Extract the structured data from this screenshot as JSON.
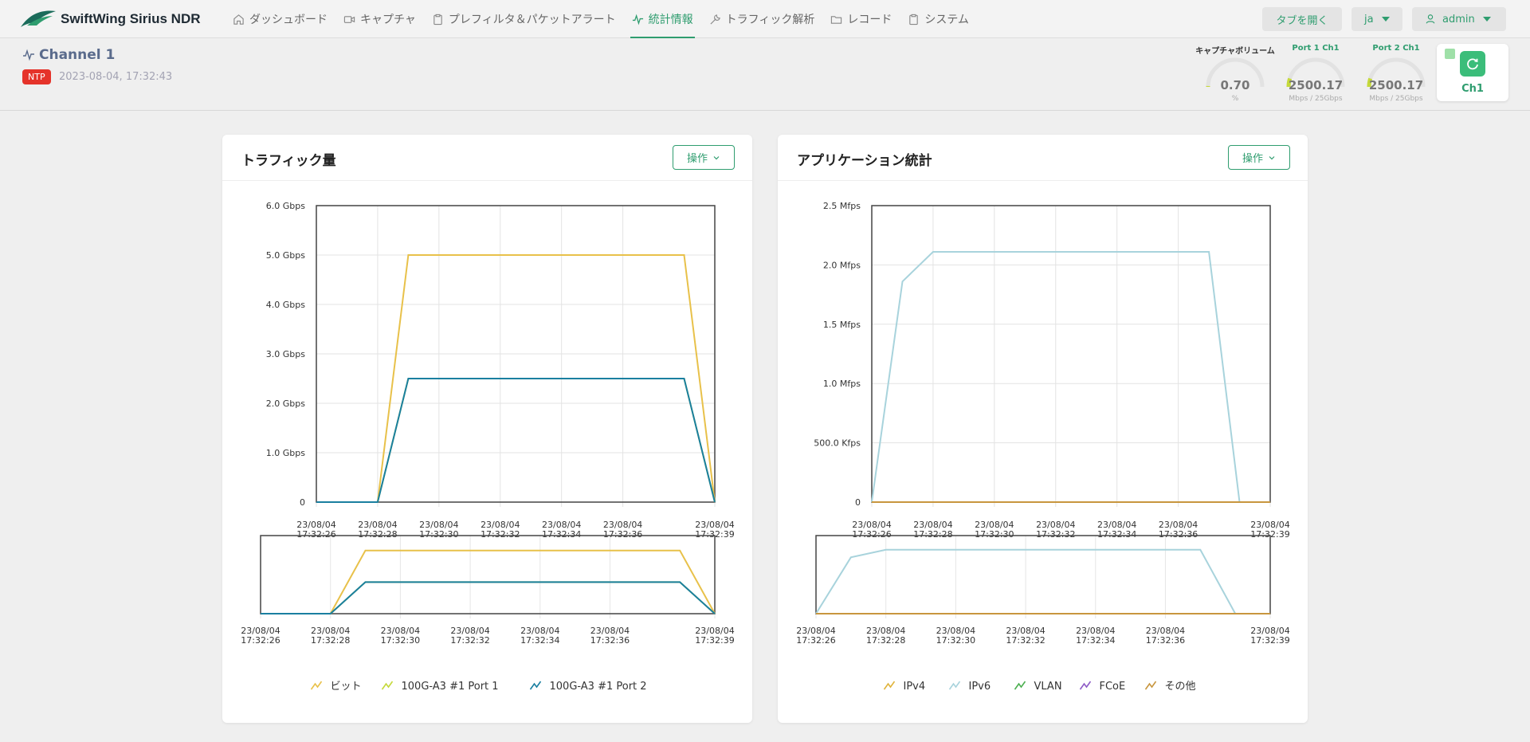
{
  "app": {
    "name": "SwiftWing Sirius NDR"
  },
  "nav": [
    {
      "label": "ダッシュボード",
      "icon": "home-icon",
      "active": false
    },
    {
      "label": "キャプチャ",
      "icon": "camera-icon",
      "active": false
    },
    {
      "label": "プレフィルタ＆パケットアラート",
      "icon": "clipboard-icon",
      "active": false
    },
    {
      "label": "統計情報",
      "icon": "activity-icon",
      "active": true
    },
    {
      "label": "トラフィック解析",
      "icon": "tools-icon",
      "active": false
    },
    {
      "label": "レコード",
      "icon": "folder-icon",
      "active": false
    },
    {
      "label": "システム",
      "icon": "clipboard-icon",
      "active": false
    }
  ],
  "toolbar": {
    "open_tab": "タブを開く",
    "language": "ja",
    "user": "admin"
  },
  "channel": {
    "title": "Channel 1",
    "badge": "NTP",
    "timestamp": "2023-08-04, 17:32:43"
  },
  "gauges": [
    {
      "label": "キャプチャボリューム",
      "value": "0.70",
      "unit": "%",
      "fraction": 0.007,
      "label_color": "#333333"
    },
    {
      "label": "Port 1 Ch1",
      "value": "2500.17",
      "unit": "Mbps / 25Gbps",
      "fraction": 0.1,
      "label_color": "#2f9d6f"
    },
    {
      "label": "Port 2 Ch1",
      "value": "2500.17",
      "unit": "Mbps / 25Gbps",
      "fraction": 0.1,
      "label_color": "#2f9d6f"
    }
  ],
  "channel_card": {
    "label": "Ch1"
  },
  "colors": {
    "accent": "#2f9d6f",
    "ntp": "#e5332a",
    "bit": "#e8c14a",
    "port1": "#c5d93a",
    "port2": "#1a7fa0",
    "ipv4": "#e0b43c",
    "ipv6": "#a8d3dc",
    "vlan": "#4caf50",
    "fcoe": "#8e5bc6",
    "other": "#c8963e"
  },
  "panels": {
    "traffic": {
      "title": "トラフィック量",
      "action": "操作"
    },
    "application": {
      "title": "アプリケーション統計",
      "action": "操作"
    }
  },
  "chart_data": [
    {
      "type": "line",
      "title": "トラフィック量",
      "ylim": [
        0,
        6
      ],
      "y_ticks": [
        "0",
        "1.0 Gbps",
        "2.0 Gbps",
        "3.0 Gbps",
        "4.0 Gbps",
        "5.0 Gbps",
        "6.0 Gbps"
      ],
      "x_range": [
        0,
        13
      ],
      "x_ticks": [
        {
          "t": 0,
          "date": "23/08/04",
          "time": "17:32:26"
        },
        {
          "t": 2,
          "date": "23/08/04",
          "time": "17:32:28"
        },
        {
          "t": 4,
          "date": "23/08/04",
          "time": "17:32:30"
        },
        {
          "t": 6,
          "date": "23/08/04",
          "time": "17:32:32"
        },
        {
          "t": 8,
          "date": "23/08/04",
          "time": "17:32:34"
        },
        {
          "t": 10,
          "date": "23/08/04",
          "time": "17:32:36"
        },
        {
          "t": 13,
          "date": "23/08/04",
          "time": "17:32:39"
        }
      ],
      "series": [
        {
          "name": "ビット",
          "color": "#e8c14a",
          "x": [
            0,
            2,
            3,
            12,
            13
          ],
          "y": [
            0,
            0,
            5.0,
            5.0,
            0
          ]
        },
        {
          "name": "100G-A3 #1 Port 1",
          "color": "#c5d93a",
          "x": [
            0,
            2,
            3,
            12,
            13
          ],
          "y": [
            0,
            0,
            2.5,
            2.5,
            0
          ]
        },
        {
          "name": "100G-A3 #1 Port 2",
          "color": "#1a7fa0",
          "x": [
            0,
            2,
            3,
            12,
            13
          ],
          "y": [
            0,
            0,
            2.5,
            2.5,
            0
          ]
        }
      ]
    },
    {
      "type": "line",
      "title": "アプリケーション統計",
      "ylim": [
        0,
        2.5
      ],
      "y_ticks": [
        "0",
        "500.0 Kfps",
        "1.0 Mfps",
        "1.5 Mfps",
        "2.0 Mfps",
        "2.5 Mfps"
      ],
      "x_range": [
        0,
        13
      ],
      "x_ticks": [
        {
          "t": 0,
          "date": "23/08/04",
          "time": "17:32:26"
        },
        {
          "t": 2,
          "date": "23/08/04",
          "time": "17:32:28"
        },
        {
          "t": 4,
          "date": "23/08/04",
          "time": "17:32:30"
        },
        {
          "t": 6,
          "date": "23/08/04",
          "time": "17:32:32"
        },
        {
          "t": 8,
          "date": "23/08/04",
          "time": "17:32:34"
        },
        {
          "t": 10,
          "date": "23/08/04",
          "time": "17:32:36"
        },
        {
          "t": 13,
          "date": "23/08/04",
          "time": "17:32:39"
        }
      ],
      "series": [
        {
          "name": "IPv4",
          "color": "#e0b43c",
          "x": [
            0,
            13
          ],
          "y": [
            0,
            0
          ]
        },
        {
          "name": "IPv6",
          "color": "#a8d3dc",
          "x": [
            0,
            1,
            2,
            11,
            12,
            13
          ],
          "y": [
            0,
            1.86,
            2.11,
            2.11,
            0,
            0
          ]
        },
        {
          "name": "VLAN",
          "color": "#4caf50",
          "x": [
            0,
            13
          ],
          "y": [
            0,
            0
          ]
        },
        {
          "name": "FCoE",
          "color": "#8e5bc6",
          "x": [
            0,
            13
          ],
          "y": [
            0,
            0
          ]
        },
        {
          "name": "その他",
          "color": "#c8963e",
          "x": [
            0,
            13
          ],
          "y": [
            0,
            0
          ]
        }
      ]
    }
  ]
}
